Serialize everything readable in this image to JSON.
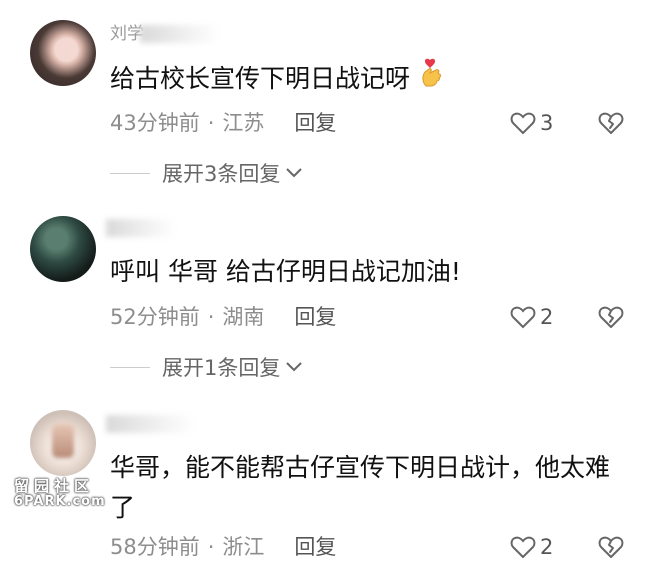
{
  "comments": [
    {
      "username": "刘学",
      "text": "给古校长宣传下明日战记呀",
      "time": "43分钟前",
      "location": "江苏",
      "reply_label": "回复",
      "likes": "3",
      "expand_label": "展开3条回复"
    },
    {
      "username": "",
      "text": "呼叫 华哥 给古仔明日战记加油!",
      "time": "52分钟前",
      "location": "湖南",
      "reply_label": "回复",
      "likes": "2",
      "expand_label": "展开1条回复"
    },
    {
      "username": "",
      "text": "华哥，能不能帮古仔宣传下明日战计，他太难了",
      "time": "58分钟前",
      "location": "浙江",
      "reply_label": "回复",
      "likes": "2"
    }
  ],
  "separator": "·",
  "watermark": {
    "cn": "留园社区",
    "en": "6PARK.com"
  },
  "icons": {
    "emoji": "finger-heart-icon",
    "like": "heart-outline-icon",
    "dislike": "broken-heart-icon",
    "expand": "chevron-down-icon"
  }
}
